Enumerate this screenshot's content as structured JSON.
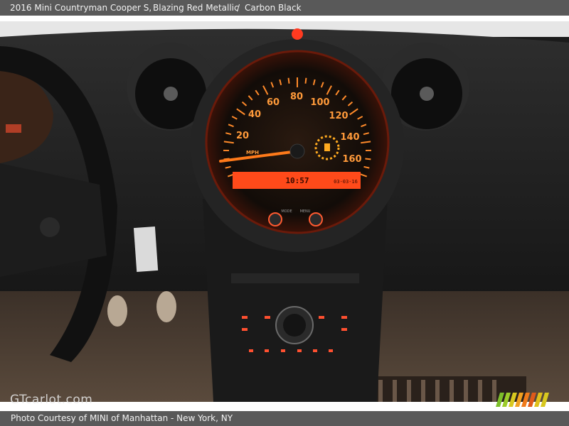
{
  "header": {
    "vehicle": "2016 Mini Countryman Cooper S,",
    "exterior": "Blazing Red Metallic",
    "separator": "/",
    "interior": "Carbon Black"
  },
  "gauge": {
    "speed_labels": [
      "20",
      "40",
      "60",
      "80",
      "100",
      "120",
      "140",
      "160"
    ],
    "unit": "MPH",
    "clock": "10:57",
    "date": "03-03-16",
    "mode_label": "MODE",
    "menu_label": "MENU"
  },
  "watermark": "GTcarlot.com",
  "footer": {
    "credit": "Photo Courtesy of MINI of Manhattan - New York, NY"
  },
  "colors": {
    "bar": "#595959",
    "gauge_glow": "#ff7a1a",
    "display": "#ff3b1a"
  }
}
